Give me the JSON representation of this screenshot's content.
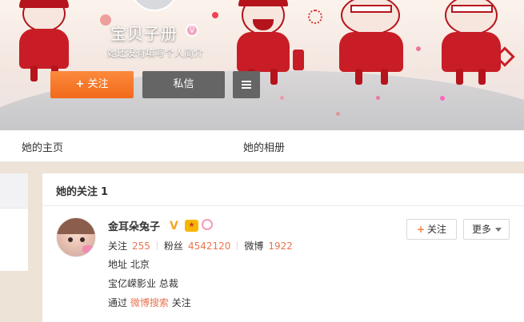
{
  "profile": {
    "nickname": "宝贝子册",
    "nickname_badge_icon": "female-badge-icon",
    "bio": "她还没有填写个人简介",
    "follow_label": "关注",
    "message_label": "私信",
    "more_icon": "menu-icon"
  },
  "nav": {
    "items": [
      {
        "label": "她的主页"
      },
      {
        "label": "她的相册"
      }
    ]
  },
  "following": {
    "title": "她的关注",
    "count": "1",
    "users": [
      {
        "name": "金耳朵兔子",
        "verified_mark": "V",
        "badges": [
          "vip-badge-icon",
          "female-icon"
        ],
        "follows_label": "关注",
        "follows": "255",
        "fans_label": "粉丝",
        "fans": "4542120",
        "weibo_label": "微博",
        "weibo": "1922",
        "location_label": "地址",
        "location": "北京",
        "title": "宝亿嵘影业 总裁",
        "via_prefix": "通过",
        "via_link": "微博搜索",
        "via_suffix": "关注",
        "follow_button": "关注",
        "more_button": "更多"
      }
    ]
  },
  "colors": {
    "accent_orange": "#f26a1b",
    "link_orange": "#eb7350",
    "dark_button": "#656565",
    "banner_red": "#c81d26",
    "verified_gold": "#f5a623"
  }
}
